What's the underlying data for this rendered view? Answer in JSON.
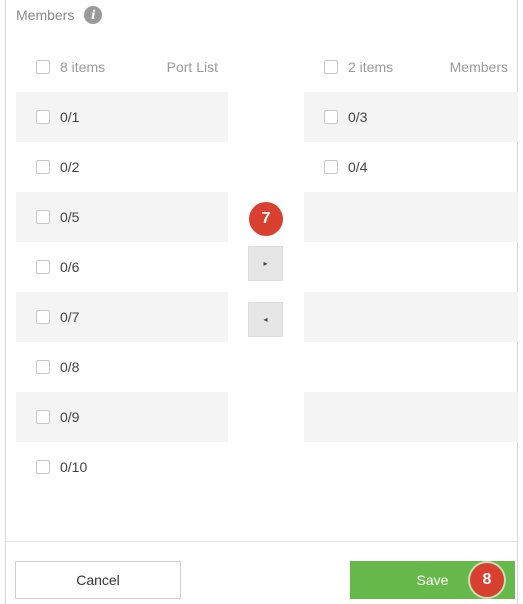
{
  "header": {
    "label": "Members",
    "info_icon": "info-icon"
  },
  "left_list": {
    "count": "8 items",
    "title": "Port List",
    "items": [
      {
        "label": "0/1"
      },
      {
        "label": "0/2"
      },
      {
        "label": "0/5"
      },
      {
        "label": "0/6"
      },
      {
        "label": "0/7"
      },
      {
        "label": "0/8"
      },
      {
        "label": "0/9"
      },
      {
        "label": "0/10"
      }
    ]
  },
  "right_list": {
    "count": "2 items",
    "title": "Members",
    "items": [
      {
        "label": "0/3"
      },
      {
        "label": "0/4"
      }
    ]
  },
  "transfer": {
    "move_right_icon": "arrow-right-icon",
    "move_left_icon": "arrow-left-icon",
    "move_right_glyph": "▸",
    "move_left_glyph": "◂"
  },
  "annotations": {
    "step_transfer": "7",
    "step_save": "8"
  },
  "footer": {
    "cancel_label": "Cancel",
    "save_label": "Save"
  },
  "colors": {
    "save": "#67b84a",
    "badge": "#d9402f",
    "row_alt": "#f4f4f4"
  }
}
